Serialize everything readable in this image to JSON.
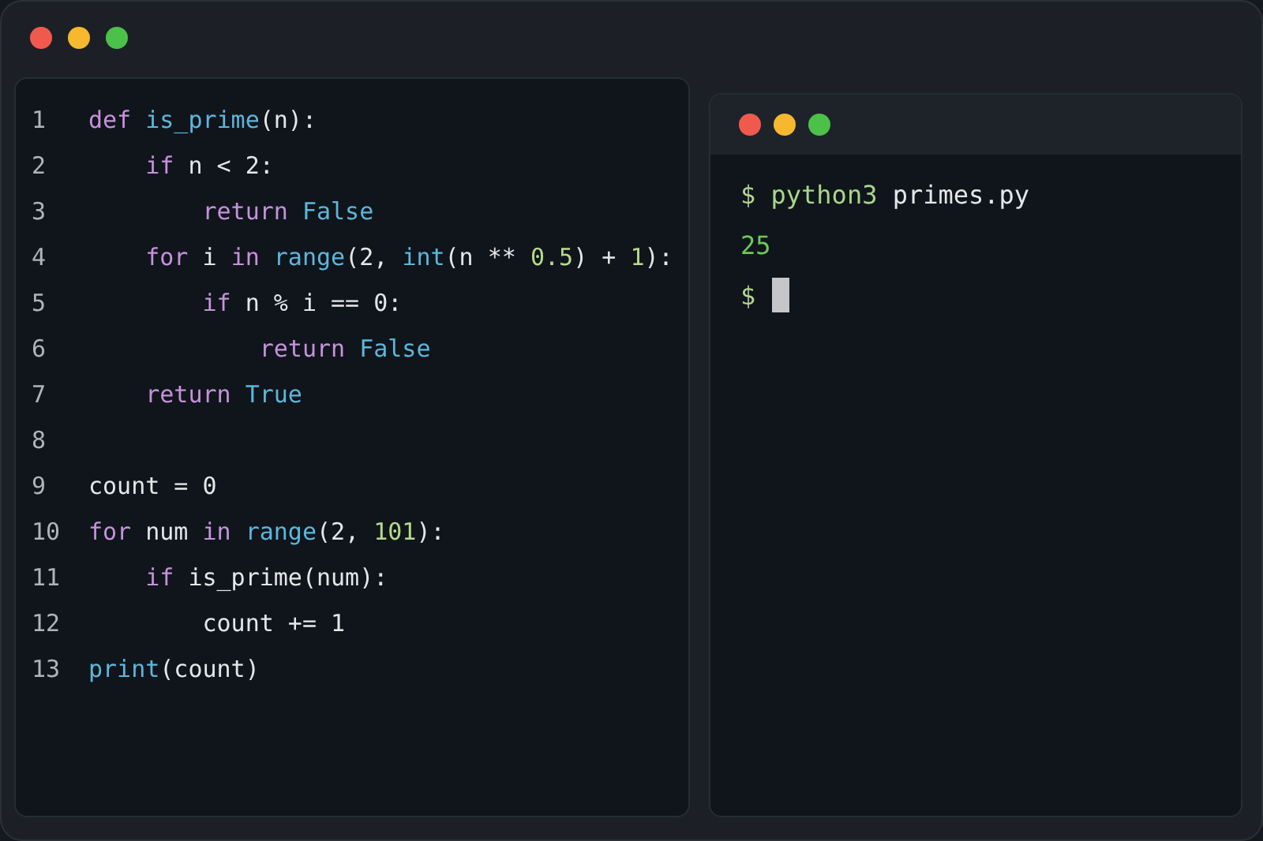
{
  "editor": {
    "lines": [
      {
        "number": "1",
        "tokens": [
          {
            "text": "def",
            "kind": "keyword"
          },
          {
            "text": " is_prime",
            "kind": "function"
          },
          {
            "text": "(n):",
            "kind": "plain"
          }
        ]
      },
      {
        "number": "2",
        "tokens": [
          {
            "text": "    if",
            "kind": "keyword"
          },
          {
            "text": " n < 2:",
            "kind": "plain"
          }
        ]
      },
      {
        "number": "3",
        "tokens": [
          {
            "text": "        return",
            "kind": "keyword"
          },
          {
            "text": " False",
            "kind": "function"
          }
        ]
      },
      {
        "number": "4",
        "tokens": [
          {
            "text": "    for",
            "kind": "keyword"
          },
          {
            "text": " i ",
            "kind": "plain"
          },
          {
            "text": "in",
            "kind": "keyword"
          },
          {
            "text": " range",
            "kind": "function"
          },
          {
            "text": "(2, ",
            "kind": "plain"
          },
          {
            "text": "int",
            "kind": "function"
          },
          {
            "text": "(n ** ",
            "kind": "plain"
          },
          {
            "text": "0.5",
            "kind": "number"
          },
          {
            "text": ") + ",
            "kind": "plain"
          },
          {
            "text": "1",
            "kind": "number"
          },
          {
            "text": "):",
            "kind": "plain"
          }
        ]
      },
      {
        "number": "5",
        "tokens": [
          {
            "text": "        if",
            "kind": "keyword"
          },
          {
            "text": " n % i == 0:",
            "kind": "plain"
          }
        ]
      },
      {
        "number": "6",
        "tokens": [
          {
            "text": "            return",
            "kind": "keyword"
          },
          {
            "text": " False",
            "kind": "function"
          }
        ]
      },
      {
        "number": "7",
        "tokens": [
          {
            "text": "    return",
            "kind": "keyword"
          },
          {
            "text": " True",
            "kind": "function"
          }
        ]
      },
      {
        "number": "8"
      },
      {
        "number": "9",
        "tokens": [
          {
            "text": "count = 0",
            "kind": "plain"
          }
        ]
      },
      {
        "number": "10",
        "tokens": [
          {
            "text": "for",
            "kind": "keyword"
          },
          {
            "text": " num ",
            "kind": "plain"
          },
          {
            "text": "in",
            "kind": "keyword"
          },
          {
            "text": " range",
            "kind": "function"
          },
          {
            "text": "(2, ",
            "kind": "plain"
          },
          {
            "text": "101",
            "kind": "number"
          },
          {
            "text": "):",
            "kind": "plain"
          }
        ]
      },
      {
        "number": "11",
        "tokens": [
          {
            "text": "    if",
            "kind": "keyword"
          },
          {
            "text": " is_prime(num):",
            "kind": "plain"
          }
        ]
      },
      {
        "number": "12",
        "tokens": [
          {
            "text": "        count += 1",
            "kind": "plain"
          }
        ]
      },
      {
        "number": "13",
        "tokens": [
          {
            "text": "print",
            "kind": "function"
          },
          {
            "text": "(count)",
            "kind": "plain"
          }
        ]
      }
    ]
  },
  "terminal": {
    "lines": [
      {
        "cursor": false,
        "tokens": [
          {
            "text": "$",
            "kind": "prompt"
          },
          {
            "text": " python3",
            "kind": "command"
          },
          {
            "text": " primes.py",
            "kind": "plain"
          }
        ]
      },
      {
        "cursor": false,
        "tokens": [
          {
            "text": "25",
            "kind": "output"
          }
        ]
      },
      {
        "cursor": true,
        "tokens": [
          {
            "text": "$",
            "kind": "prompt"
          }
        ]
      }
    ]
  }
}
